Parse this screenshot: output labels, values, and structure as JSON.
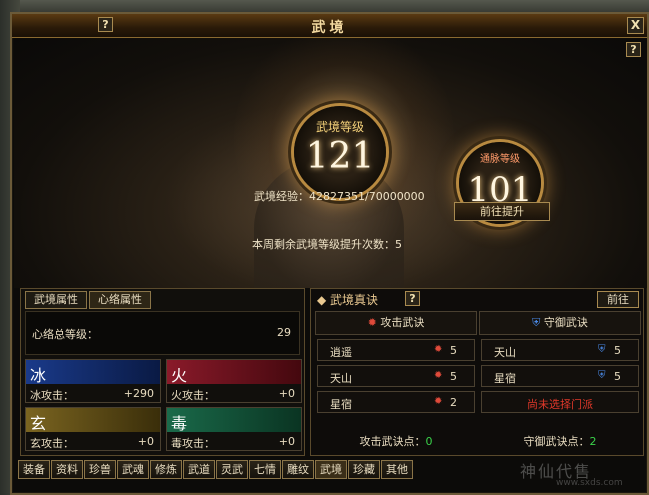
{
  "window": {
    "title": "武境",
    "help": "?",
    "close": "X"
  },
  "hero": {
    "level_label": "武境等级",
    "level_value": "121",
    "meridian_label": "通脉等级",
    "meridian_value": "101",
    "exp_text": "武境经验：42827351/70000000",
    "go_upgrade": "前往提升",
    "weekly_text": "本周剩余武境等级提升次数：5"
  },
  "left": {
    "tabs": [
      "武境属性",
      "心络属性"
    ],
    "total_label": "心络总等级：",
    "total_value": "29",
    "elements": [
      {
        "char": "冰",
        "label": "冰攻击：",
        "value": "+290"
      },
      {
        "char": "火",
        "label": "火攻击：",
        "value": "+0"
      },
      {
        "char": "玄",
        "label": "玄攻击：",
        "value": "+0"
      },
      {
        "char": "毒",
        "label": "毒攻击：",
        "value": "+0"
      }
    ]
  },
  "right": {
    "title": "◆ 武境真诀",
    "go": "前往",
    "attack": {
      "header": "攻击武诀",
      "rows": [
        {
          "name": "逍遥",
          "level": "5"
        },
        {
          "name": "天山",
          "level": "5"
        },
        {
          "name": "星宿",
          "level": "2"
        }
      ],
      "points_label": "攻击武诀点：",
      "points": "0"
    },
    "defense": {
      "header": "守御武诀",
      "rows": [
        {
          "name": "天山",
          "level": "5"
        },
        {
          "name": "星宿",
          "level": "5"
        }
      ],
      "empty": "尚未选择门派",
      "points_label": "守御武诀点：",
      "points": "2"
    }
  },
  "bottom_tabs": [
    "装备",
    "资料",
    "珍兽",
    "武魂",
    "修炼",
    "武道",
    "灵武",
    "七情",
    "雕纹",
    "武境",
    "珍藏",
    "其他"
  ],
  "active_bottom_tab": "武境",
  "watermark": {
    "text": "神仙代售",
    "url": "www.sxds.com"
  }
}
